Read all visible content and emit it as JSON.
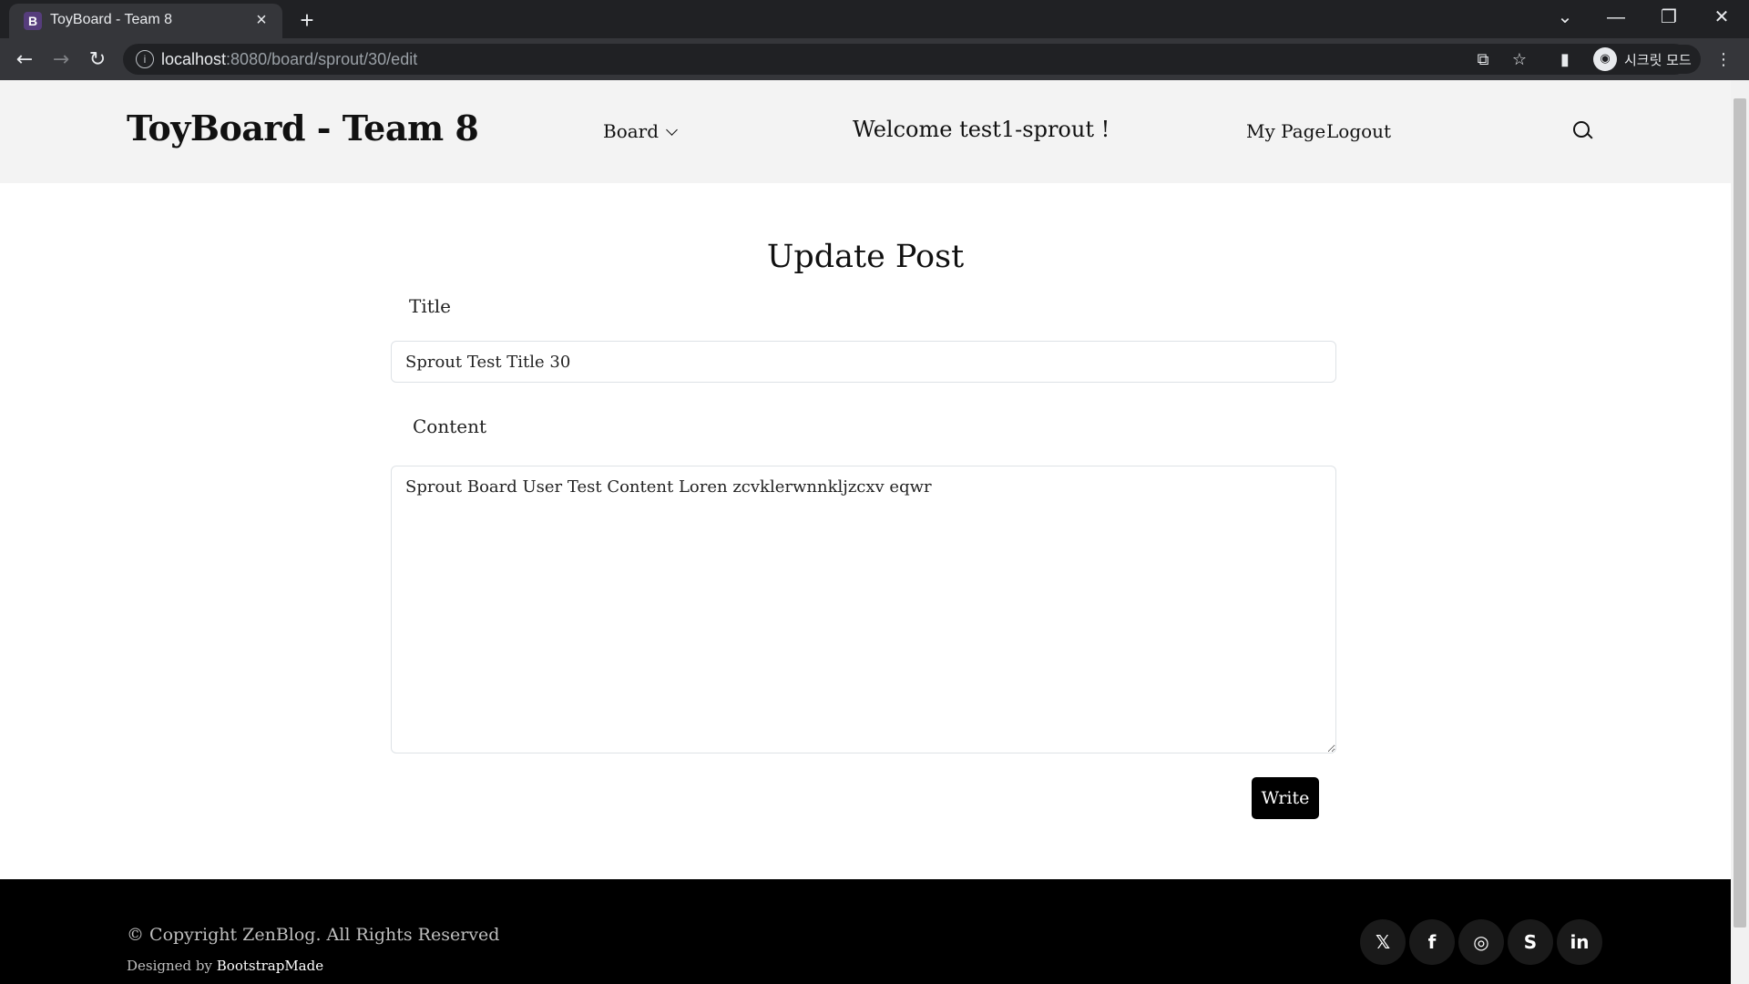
{
  "browser": {
    "tab_title": "ToyBoard - Team 8",
    "tab_favicon": "B",
    "tab_close": "×",
    "new_tab": "+",
    "url_host": "localhost",
    "url_path": ":8080/board/sprout/30/edit",
    "profile_label": "시크릿 모드",
    "window_controls": {
      "tablist": "⌄",
      "minimize": "—",
      "restore": "❐",
      "close": "✕"
    },
    "nav_icons": {
      "back": "←",
      "forward": "→",
      "reload": "↻"
    },
    "toolbar_icons": {
      "translate": "⧉",
      "bookmark": "☆",
      "sidepanel": "▮",
      "menu": "⋮"
    }
  },
  "header": {
    "brand": "ToyBoard - Team 8",
    "nav_board": "Board",
    "welcome": "Welcome test1-sprout !",
    "nav_mypage": "My Page",
    "nav_logout": "Logout"
  },
  "form": {
    "heading": "Update Post",
    "title_label": "Title",
    "title_value": "Sprout Test Title 30",
    "content_label": "Content",
    "content_value": "Sprout Board User Test Content Loren zcvklerwnnkljzcxv eqwr",
    "submit_label": "Write"
  },
  "footer": {
    "copyright": "© Copyright ZenBlog. All Rights Reserved",
    "designed_by": "Designed by ",
    "designer_link": "BootstrapMade",
    "social_icons": [
      "twitter-icon",
      "facebook-icon",
      "instagram-icon",
      "skype-icon",
      "linkedin-icon"
    ]
  },
  "colors": {
    "header_bg": "#f3f3f3",
    "footer_bg": "#000000",
    "button_bg": "#000000",
    "chrome_bg": "#202124"
  }
}
